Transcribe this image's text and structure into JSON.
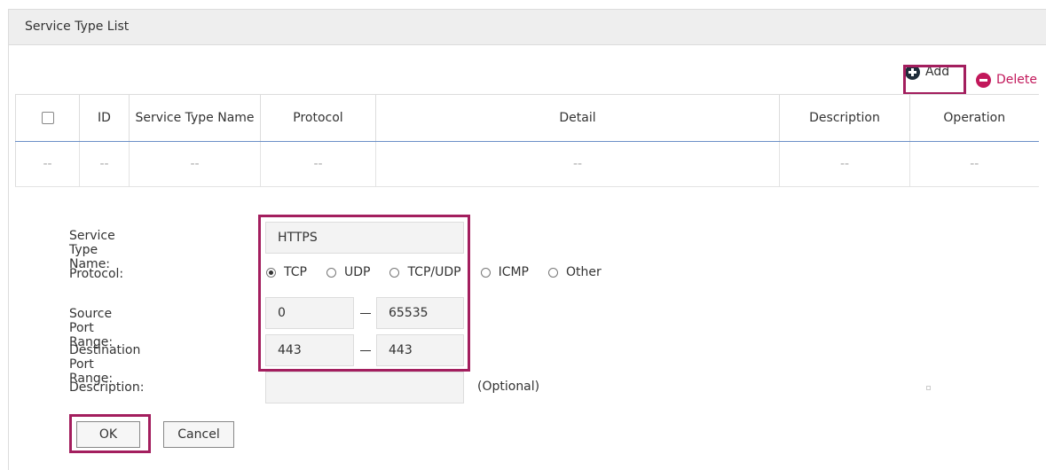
{
  "panel": {
    "title": "Service Type List"
  },
  "toolbar": {
    "add_label": "Add",
    "delete_label": "Delete",
    "add_icon": "plus-circle-icon",
    "delete_icon": "minus-circle-icon",
    "accent_color": "#c2185b",
    "highlight_color": "#a31e5e"
  },
  "table": {
    "columns": [
      "ID",
      "Service Type Name",
      "Protocol",
      "Detail",
      "Description",
      "Operation"
    ],
    "empty_row": [
      "--",
      "--",
      "--",
      "--",
      "--",
      "--",
      "--"
    ]
  },
  "form": {
    "service_type_name": {
      "label": "Service Type Name:",
      "value": "HTTPS"
    },
    "protocol": {
      "label": "Protocol:",
      "options": [
        "TCP",
        "UDP",
        "TCP/UDP",
        "ICMP",
        "Other"
      ],
      "selected": "TCP"
    },
    "source_port_range": {
      "label": "Source Port Range:",
      "from": "0",
      "to": "65535"
    },
    "destination_port_range": {
      "label": "Destination Port Range:",
      "from": "443",
      "to": "443"
    },
    "description": {
      "label": "Description:",
      "value": "",
      "hint": "(Optional)"
    },
    "ok_label": "OK",
    "cancel_label": "Cancel"
  }
}
